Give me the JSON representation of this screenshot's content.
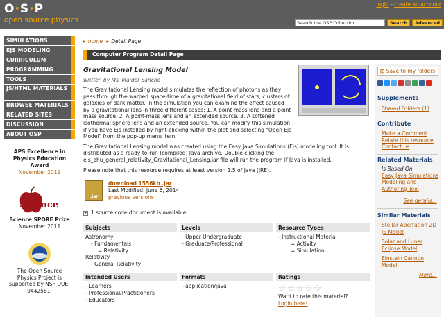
{
  "header": {
    "logo_letters": [
      "O",
      "S",
      "P"
    ],
    "logo_sub": "open source physics",
    "login": "login",
    "create_account": "create an account",
    "link_sep": " - ",
    "search_placeholder": "Search the OSP Collection...",
    "search_btn": "Search",
    "advanced_btn": "Advanced"
  },
  "leftnav": {
    "items": [
      "SIMULATIONS",
      "EJS MODELING",
      "CURRICULUM",
      "PROGRAMMING",
      "TOOLS",
      "JS/HTML MATERIALS",
      "BROWSE MATERIALS",
      "RELATED SITES",
      "DISCUSSION",
      "ABOUT OSP"
    ],
    "award1_title": "APS Excellence in Physics Education Award",
    "award1_date": "November 2019",
    "award2_logo": "Science",
    "award2_title": "Science SPORE Prize",
    "award2_date": "November 2011",
    "award3_text": "The Open Source Physics Project is supported by NSF DUE-0442581."
  },
  "breadcrumb": {
    "home": "home",
    "current": "Detail Page"
  },
  "titlebar": "Computer Program Detail Page",
  "resource": {
    "title": "Gravitational Lensing Model",
    "author": "written by Ms. Maider Sancho",
    "para1": "The Gravitational Lensing model simulates the reflection of photons as they pass through the warped space-time of a gravitational field of stars, clusters of galaxies or dark matter. In the simulation you can examine the effect caused by a gravitational lens in three different cases: 1. A point-mass lens and a point mass source. 2. A point-mass lens and an extended source. 3. A softened isothermal sphere lens and an extended source. You can modify this simulation if you have Ejs installed by right-clicking within the plot and selecting \"Open Ejs Model\" from the pop-up menu item.",
    "para2": "The Gravitational Lensing model was created using the Easy Java Simulations (Ejs) modeling tool.  It is distributed as a ready-to-run (compiled) Java archive.  Double clicking the ejs_ehu_general_relativity_Gravitational_Lensing.jar file will run the program if Java is installed.",
    "para3": "Please note that this resource requires at least version 1.5 of Java (JRE)."
  },
  "download": {
    "icon_label": ".jar",
    "link": "download 1556kb .jar",
    "modified": "Last Modified: June 6, 2014",
    "previous": "previous versions"
  },
  "source_doc": "1 source code document is available",
  "meta": {
    "subjects_head": "Subjects",
    "levels_head": "Levels",
    "resource_types_head": "Resource Types",
    "subjects": [
      {
        "text": "Astronomy",
        "indent": 0
      },
      {
        "text": "- Fundamentals",
        "indent": 1
      },
      {
        "text": "= Relativity",
        "indent": 2
      },
      {
        "text": "Relativity",
        "indent": 0
      },
      {
        "text": "- General Relativity",
        "indent": 1
      }
    ],
    "levels": [
      "- Upper Undergraduate",
      "- Graduate/Professional"
    ],
    "resource_types": [
      {
        "text": "- Instructional Material",
        "indent": 0
      },
      {
        "text": "= Activity",
        "indent": 2
      },
      {
        "text": "= Simulation",
        "indent": 2
      }
    ],
    "users_head": "Intended Users",
    "formats_head": "Formats",
    "ratings_head": "Ratings",
    "users": [
      "- Learners",
      "- Professional/Practitioners",
      "- Educators"
    ],
    "formats": [
      "- application/java"
    ],
    "rate_question": "Want to rate this material?",
    "rate_login": "Login here!",
    "star_glyph": "☆"
  },
  "rightbar": {
    "save": "Save to my folders",
    "share_colors": [
      "#3b5998",
      "#1e90ff",
      "#55acee",
      "#cc3333",
      "#8e8e8e",
      "#3aa655",
      "#336699",
      "#d62d20"
    ],
    "supplements_head": "Supplements",
    "shared_folders": "Shared Folders (1)",
    "contribute_head": "Contribute",
    "contribute": [
      "Make a Comment",
      "Relate this resource",
      "Contact us"
    ],
    "related_head": "Related Materials",
    "is_based_on": "Is Based On",
    "related_link": "Easy Java Simulations Modeling and Authoring Tool",
    "see_details": "See details...",
    "similar_head": "Similar Materials",
    "similar": [
      "Stellar Aberration 2D JS Model",
      "Solar and Lunar Eclipse Model",
      "Einstein Cannon Model"
    ],
    "more": "More..."
  }
}
